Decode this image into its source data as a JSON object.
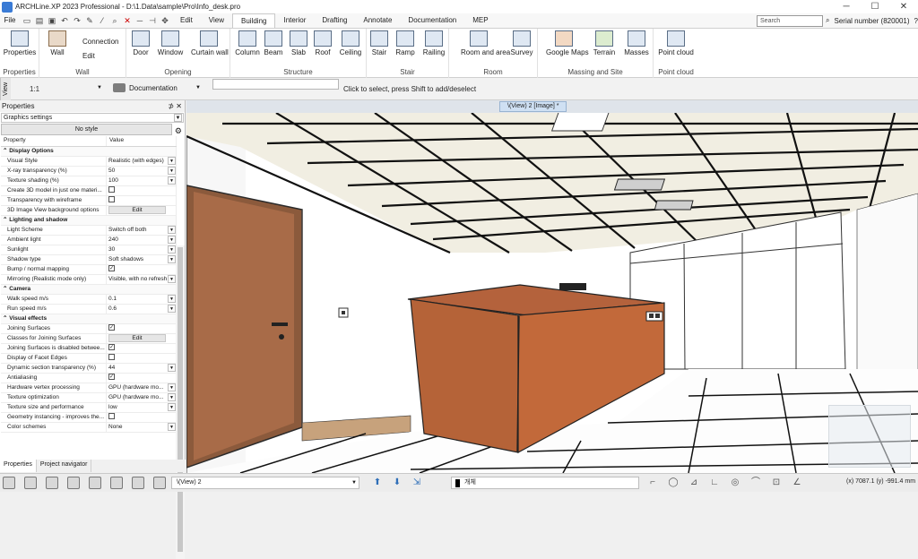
{
  "window": {
    "title": "ARCHLine.XP 2023  Professional - D:\\1.Data\\sample\\Pro\\Info_desk.pro",
    "controls": [
      "─",
      "☐",
      "✕"
    ]
  },
  "tabs": {
    "file": "File",
    "items": [
      "Edit",
      "View",
      "Building",
      "Interior",
      "Drafting",
      "Annotate",
      "Documentation",
      "MEP"
    ],
    "active": "Building",
    "search_placeholder": "Search",
    "serial": "Serial number (820001)"
  },
  "ribbon": {
    "groups": [
      {
        "name": "Properties",
        "buttons": [
          "Properties"
        ]
      },
      {
        "name": "Wall",
        "buttons": [
          "Wall",
          "Connection",
          "Edit"
        ]
      },
      {
        "name": "Opening",
        "buttons": [
          "Door",
          "Window",
          "Curtain wall"
        ]
      },
      {
        "name": "Structure",
        "buttons": [
          "Column",
          "Beam",
          "Slab",
          "Roof",
          "Ceiling"
        ]
      },
      {
        "name": "Stair",
        "buttons": [
          "Stair",
          "Ramp",
          "Railing"
        ]
      },
      {
        "name": "Room",
        "buttons": [
          "Room and area",
          "Survey"
        ]
      },
      {
        "name": "Massing and Site",
        "buttons": [
          "Google Maps",
          "Terrain",
          "Masses"
        ]
      },
      {
        "name": "Point cloud",
        "buttons": [
          "Point cloud"
        ]
      }
    ]
  },
  "toolbar": {
    "view_tab": "View",
    "scale": "1:1",
    "doc": "Documentation",
    "hint": "Click to select, press Shift to add/deselect"
  },
  "properties": {
    "title": "Properties",
    "selector": "Graphics settings",
    "style_button": "No style",
    "col_property": "Property",
    "col_value": "Value",
    "rows": [
      {
        "type": "hdr",
        "label": "Display Options"
      },
      {
        "label": "Visual Style",
        "value": "Realistic (with edges)",
        "kind": "combo"
      },
      {
        "label": "X-ray transparency (%)",
        "value": "50",
        "kind": "combo"
      },
      {
        "label": "Texture shading (%)",
        "value": "100",
        "kind": "combo"
      },
      {
        "label": "Create 3D model in just one materi...",
        "value": "",
        "kind": "check",
        "checked": false
      },
      {
        "label": "Transparency with wireframe",
        "value": "",
        "kind": "check",
        "checked": false
      },
      {
        "label": "3D Image View background options",
        "value": "Edit",
        "kind": "button"
      },
      {
        "type": "hdr",
        "label": "Lighting and shadow"
      },
      {
        "label": "Light Scheme",
        "value": "Switch off both",
        "kind": "combo"
      },
      {
        "label": "Ambient light",
        "value": "240",
        "kind": "combo"
      },
      {
        "label": "Sunlight",
        "value": "30",
        "kind": "combo"
      },
      {
        "label": "Shadow type",
        "value": "Soft shadows",
        "kind": "combo"
      },
      {
        "label": "Bump / normal mapping",
        "value": "",
        "kind": "check",
        "checked": true
      },
      {
        "label": "Mirroring (Realistic mode only)",
        "value": "Visible, with no refresh",
        "kind": "combo"
      },
      {
        "type": "hdr",
        "label": "Camera"
      },
      {
        "label": "Walk speed m/s",
        "value": "0.1",
        "kind": "combo"
      },
      {
        "label": "Run speed m/s",
        "value": "0.6",
        "kind": "combo"
      },
      {
        "type": "hdr",
        "label": "Visual effects"
      },
      {
        "label": "Joining Surfaces",
        "value": "",
        "kind": "check",
        "checked": true
      },
      {
        "label": "Classes for Joining Surfaces",
        "value": "Edit",
        "kind": "button"
      },
      {
        "label": "Joining Surfaces is disabled betwee...",
        "value": "",
        "kind": "check",
        "checked": true
      },
      {
        "label": "Display of Facet Edges",
        "value": "",
        "kind": "check",
        "checked": false
      },
      {
        "label": "Dynamic section transparency (%)",
        "value": "44",
        "kind": "combo"
      },
      {
        "label": "Antialiasing",
        "value": "",
        "kind": "check",
        "checked": true
      },
      {
        "label": "Hardware vertex processing",
        "value": "GPU (hardware mo...",
        "kind": "combo"
      },
      {
        "label": "Texture optimization",
        "value": "GPU (hardware mo...",
        "kind": "combo"
      },
      {
        "label": "Texture size and performance",
        "value": "low",
        "kind": "combo"
      },
      {
        "label": "Geometry instancing - improves the...",
        "value": "",
        "kind": "check",
        "checked": false
      },
      {
        "label": "Color schemes",
        "value": "None",
        "kind": "combo"
      }
    ],
    "tabs": [
      "Properties",
      "Project navigator"
    ]
  },
  "viewport": {
    "tab": "\\(View) 2 [Image] *"
  },
  "status": {
    "view_select": "\\(View) 2",
    "layer": "개체",
    "coords": "(x) 7087.1   (y) -991.4 mm"
  }
}
